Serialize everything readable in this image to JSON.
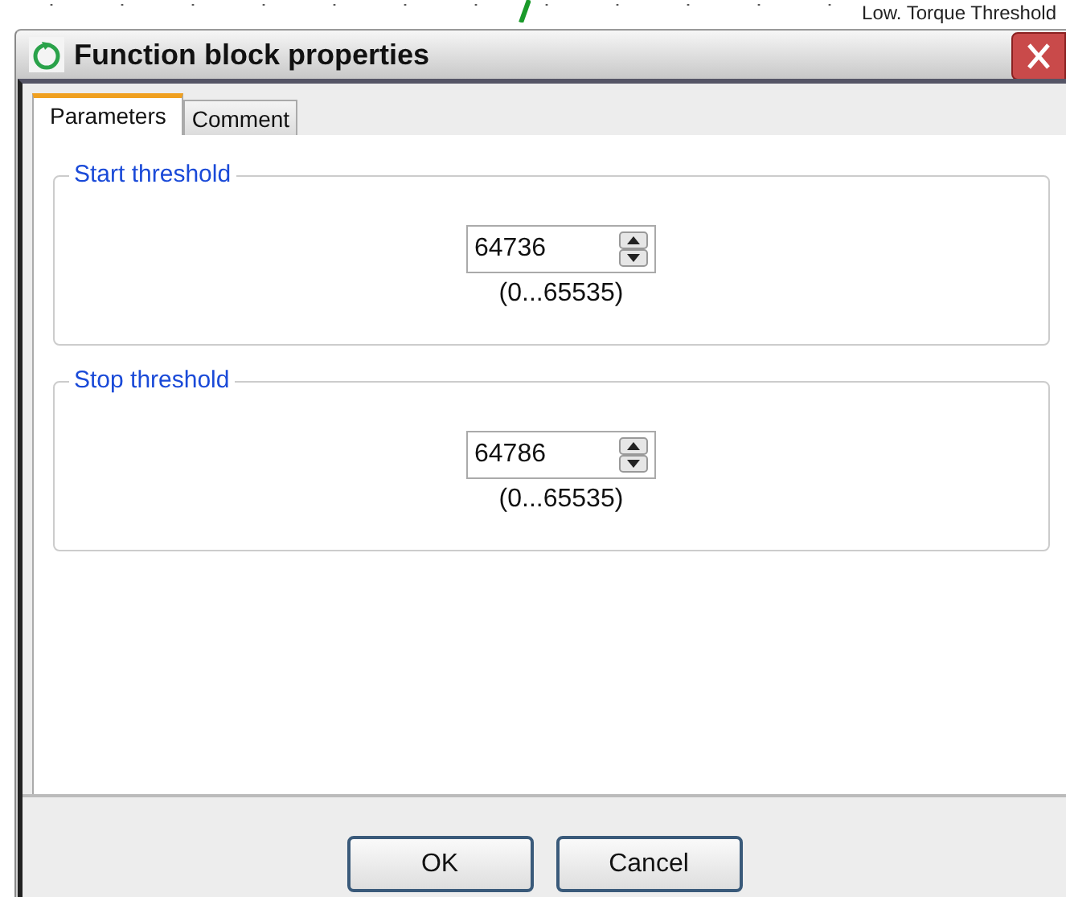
{
  "background": {
    "text": "Low. Torque Threshold"
  },
  "window": {
    "title": "Function block properties"
  },
  "tabs": [
    {
      "label": "Parameters",
      "selected": true
    },
    {
      "label": "Comment",
      "selected": false
    }
  ],
  "groups": [
    {
      "title": "Start threshold",
      "value": "64736",
      "range": "(0...65535)"
    },
    {
      "title": "Stop threshold",
      "value": "64786",
      "range": "(0...65535)"
    }
  ],
  "buttons": [
    "OK",
    "Cancel"
  ]
}
